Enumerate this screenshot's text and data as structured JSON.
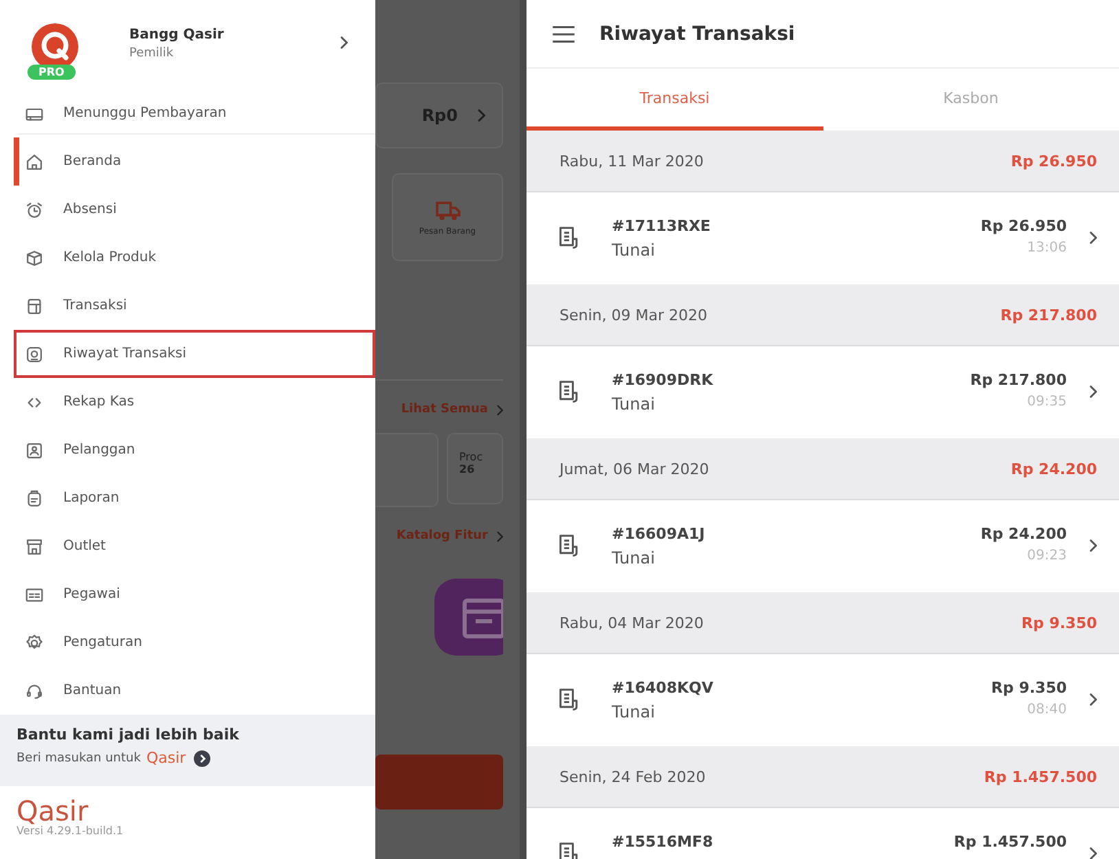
{
  "drawer": {
    "profile": {
      "name": "Bangg Qasir",
      "role": "Pemilik",
      "badge": "PRO"
    },
    "items": [
      {
        "label": "Menunggu Pembayaran",
        "selected": false,
        "highlighted": false
      },
      {
        "label": "Beranda",
        "selected": true,
        "highlighted": false
      },
      {
        "label": "Absensi",
        "selected": false,
        "highlighted": false
      },
      {
        "label": "Kelola Produk",
        "selected": false,
        "highlighted": false
      },
      {
        "label": "Transaksi",
        "selected": false,
        "highlighted": false
      },
      {
        "label": "Riwayat Transaksi",
        "selected": false,
        "highlighted": true
      },
      {
        "label": "Rekap Kas",
        "selected": false,
        "highlighted": false
      },
      {
        "label": "Pelanggan",
        "selected": false,
        "highlighted": false
      },
      {
        "label": "Laporan",
        "selected": false,
        "highlighted": false
      },
      {
        "label": "Outlet",
        "selected": false,
        "highlighted": false
      },
      {
        "label": "Pegawai",
        "selected": false,
        "highlighted": false
      },
      {
        "label": "Pengaturan",
        "selected": false,
        "highlighted": false
      },
      {
        "label": "Bantuan",
        "selected": false,
        "highlighted": false
      }
    ],
    "feedback": {
      "title": "Bantu kami jadi lebih baik",
      "prompt": "Beri masukan untuk",
      "brand": "Qasir"
    },
    "footer": {
      "logo": "Qasir",
      "version": "Versi 4.29.1-build.1"
    }
  },
  "background_screen": {
    "balance": "Rp0",
    "shortcut": "Pesan Barang",
    "link_1": "Lihat Semua",
    "card_label": "Proc",
    "card_value": "26",
    "link_2": "Katalog Fitur"
  },
  "history": {
    "title": "Riwayat Transaksi",
    "tabs": [
      {
        "label": "Transaksi",
        "selected": true
      },
      {
        "label": "Kasbon",
        "selected": false
      }
    ],
    "groups": [
      {
        "date": "Rabu, 11 Mar 2020",
        "total": "Rp 26.950",
        "transactions": [
          {
            "id": "#17113RXE",
            "method": "Tunai",
            "amount": "Rp 26.950",
            "time": "13:06"
          }
        ]
      },
      {
        "date": "Senin, 09 Mar 2020",
        "total": "Rp 217.800",
        "transactions": [
          {
            "id": "#16909DRK",
            "method": "Tunai",
            "amount": "Rp 217.800",
            "time": "09:35"
          }
        ]
      },
      {
        "date": "Jumat, 06 Mar 2020",
        "total": "Rp 24.200",
        "transactions": [
          {
            "id": "#16609A1J",
            "method": "Tunai",
            "amount": "Rp 24.200",
            "time": "09:23"
          }
        ]
      },
      {
        "date": "Rabu, 04 Mar 2020",
        "total": "Rp 9.350",
        "transactions": [
          {
            "id": "#16408KQV",
            "method": "Tunai",
            "amount": "Rp 9.350",
            "time": "08:40"
          }
        ]
      },
      {
        "date": "Senin, 24 Feb 2020",
        "total": "Rp 1.457.500",
        "transactions": [
          {
            "id": "#15516MF8",
            "amount": "Rp 1.457.500"
          }
        ]
      }
    ]
  }
}
